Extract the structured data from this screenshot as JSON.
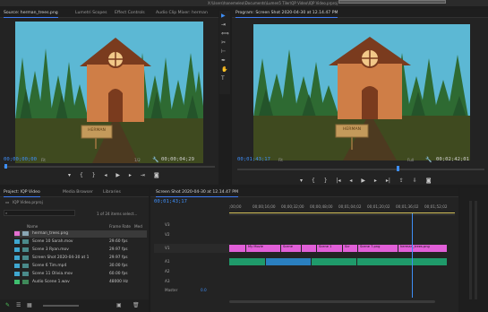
{
  "window": {
    "title": "X:\\Users\\hanemelea\\Documents\\Lumen5 Tiler\\QP Video\\IQP Video.prproj *"
  },
  "source_panel": {
    "tabs": [
      "Source: herman_trees.png",
      "Lumetri Scopes",
      "Effect Controls",
      "Audio Clip Mixer: herman"
    ],
    "timecode": "00;00;00;00",
    "fit": "Fit",
    "resolution": "1/2",
    "duration": "00;00;04;29",
    "sign_text": "HERMAN"
  },
  "program_panel": {
    "title": "Program: Screen Shot 2020-04-30 at 12.14.47 PM",
    "timecode": "00;01;43;17",
    "fit": "Fit",
    "resolution": "Full",
    "duration": "00;02;42;01",
    "sign_text": "HERMAN"
  },
  "transport_icons": [
    "marker-icon",
    "in-point-icon",
    "out-point-icon",
    "go-to-in-icon",
    "step-back-icon",
    "play-icon",
    "step-forward-icon",
    "go-to-out-icon",
    "insert-icon",
    "overwrite-icon",
    "export-frame-icon"
  ],
  "project_panel": {
    "tabs": [
      "Project: IQP Video",
      "Media Browser",
      "Libraries"
    ],
    "project_file": "IQP Video.prproj",
    "item_count": "1 of 24 items select...",
    "columns": [
      "Name",
      "Frame Rate",
      "Med"
    ],
    "rows": [
      {
        "name": "herman_trees.png",
        "rate": "",
        "color": "#e36fd0"
      },
      {
        "name": "Scene 10 Sarah.mov",
        "rate": "29.60 fps",
        "color": "#3fa7d0"
      },
      {
        "name": "Scene 3 Ryan.mov",
        "rate": "29.97 fps",
        "color": "#3fa7d0"
      },
      {
        "name": "Screen Shot 2020-04-30 at 1",
        "rate": "29.97 fps",
        "color": "#3fa7d0"
      },
      {
        "name": "Scene 6 Tim.mp4",
        "rate": "30.00 fps",
        "color": "#3fa7d0"
      },
      {
        "name": "Scene 11 Olivia.mov",
        "rate": "60.00 fps",
        "color": "#3fa7d0"
      },
      {
        "name": "Audio Scene 1.wav",
        "rate": "48000 Hz",
        "color": "#3fbf6f"
      }
    ]
  },
  "timeline": {
    "tab": "Screen Shot 2020-04-30 at 12.14.47 PM",
    "timecode": "00;01;43;17",
    "ruler": [
      ";00;00",
      "00;00;16;00",
      "00;00;32;00",
      "00;00;48;00",
      "00;01;04;02",
      "00;01;20;02",
      "00;01;36;02",
      "00;01;52;02"
    ],
    "tracks": [
      "V3",
      "V2",
      "V1",
      "A1",
      "A2",
      "A3"
    ],
    "master": "Master",
    "master_value": "0.0",
    "clips_v1": [
      {
        "label": "",
        "color": "#e15fd8"
      },
      {
        "label": "My Movie",
        "color": "#e15fd8"
      },
      {
        "label": "Scene",
        "color": "#e15fd8"
      },
      {
        "label": "",
        "color": "#e15fd8"
      },
      {
        "label": "Scene 1",
        "color": "#e15fd8"
      },
      {
        "label": "Scr",
        "color": "#e15fd8"
      },
      {
        "label": "Scene 7.png",
        "color": "#e15fd8"
      },
      {
        "label": "herman_trees.png",
        "color": "#e15fd8"
      }
    ]
  },
  "colors": {
    "accent": "#3e8ef7",
    "sky": "#5cb8d4",
    "house": "#cf7e47",
    "tree": "#2e6a32"
  }
}
